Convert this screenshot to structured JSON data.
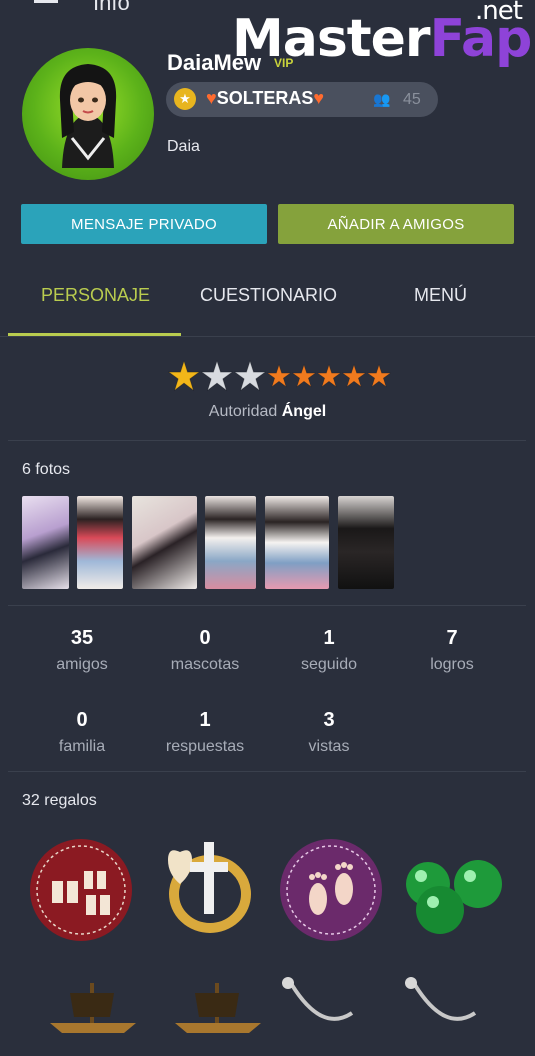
{
  "topbar": {
    "title": "Info"
  },
  "watermark": {
    "master": "Master",
    "fap": "Fap",
    "net": ".net"
  },
  "profile": {
    "username": "DaiaMew",
    "vip": "VIP",
    "club_name": "SOLTERAS",
    "club_members": "45",
    "status": "Daia"
  },
  "buttons": {
    "message": "MENSAJE PRIVADO",
    "add_friend": "AÑADIR A AMIGOS"
  },
  "tabs": [
    "PERSONAJE",
    "CUESTIONARIO",
    "MENÚ"
  ],
  "authority": {
    "label": "Autoridad",
    "value": "Ángel",
    "stars_gold": 1,
    "stars_silver": 2,
    "stars_orange": 5
  },
  "photos": {
    "label": "6 fotos",
    "count": 6
  },
  "stats": [
    {
      "value": "35",
      "label": "amigos"
    },
    {
      "value": "0",
      "label": "mascotas"
    },
    {
      "value": "1",
      "label": "seguido"
    },
    {
      "value": "7",
      "label": "logros"
    },
    {
      "value": "0",
      "label": "familia"
    },
    {
      "value": "1",
      "label": "respuestas"
    },
    {
      "value": "3",
      "label": "vistas"
    }
  ],
  "gifts": {
    "label": "32 regalos"
  },
  "colors": {
    "background": "#2a2f3c",
    "message_button": "#2ba3ba",
    "add_button": "#85a23c",
    "active_tab": "#b9cc4f"
  }
}
